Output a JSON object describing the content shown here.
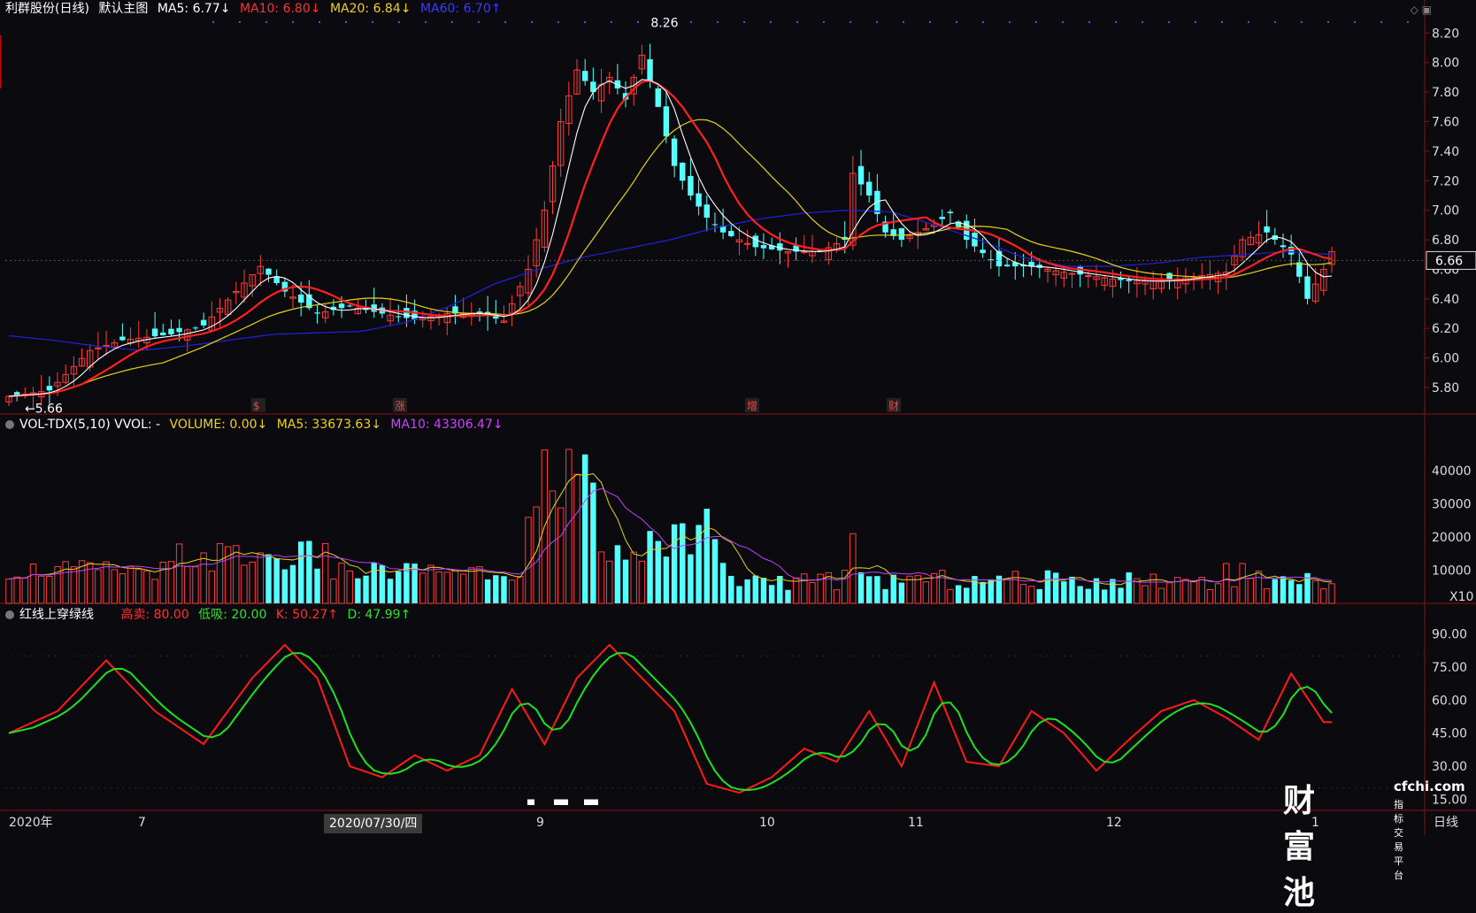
{
  "main_header": {
    "title": "利群股份(日线)",
    "subtitle": "默认主图",
    "ma5": "MA5: 6.77↓",
    "ma10": "MA10: 6.80↓",
    "ma20": "MA20: 6.84↓",
    "ma60": "MA60: 6.70↑"
  },
  "vol_header": {
    "name": "VOL-TDX(5,10) VVOL: -",
    "volume": "VOLUME: 0.00↓",
    "ma5": "MA5: 33673.63↓",
    "ma10": "MA10: 43306.47↓"
  },
  "kdj_header": {
    "name": "红线上穿绿线",
    "high": "高卖: 80.00",
    "low": "低吸: 20.00",
    "k": "K: 50.27↑",
    "d": "D: 47.99↑"
  },
  "price_axis": [
    "8.20",
    "8.00",
    "7.80",
    "7.60",
    "7.40",
    "7.20",
    "7.00",
    "6.80",
    "6.60",
    "6.40",
    "6.20",
    "6.00",
    "5.80"
  ],
  "current_price": "6.66",
  "high_marker": "8.26",
  "low_marker": "←5.66",
  "event_markers": [
    "$",
    "涨",
    "增",
    "财"
  ],
  "vol_axis": [
    "40000",
    "30000",
    "20000",
    "10000",
    "X10"
  ],
  "kdj_axis": [
    "90.00",
    "75.00",
    "60.00",
    "45.00",
    "30.00",
    "15.00"
  ],
  "x_axis": [
    "2020年",
    "7",
    "9",
    "10",
    "11",
    "12",
    "1"
  ],
  "cursor_date": "2020/07/30/四",
  "period_label": "日线",
  "watermark": {
    "brand": "财富池",
    "domain": "cfchi.com",
    "tagline": "指标交易平台"
  },
  "colors": {
    "up": "#ff3b3b",
    "down": "#54ffff",
    "ma5": "#ffffff",
    "ma10": "#ff2020",
    "ma20": "#e6d21a",
    "ma60": "#2020d0",
    "vma10": "#c040ff",
    "k": "#ff1a1a",
    "d": "#20e020"
  },
  "chart_data": {
    "type": "line",
    "title": "利群股份(日线)",
    "ylim": [
      5.6,
      8.3
    ],
    "series": [
      {
        "name": "MA60",
        "values": [
          6.15,
          6.12,
          6.08,
          6.05,
          6.08,
          6.12,
          6.16,
          6.17,
          6.18,
          6.24,
          6.35,
          6.5,
          6.6,
          6.68,
          6.74,
          6.8,
          6.88,
          6.94,
          6.98,
          7.0,
          6.99,
          6.9,
          6.8,
          6.68,
          6.62,
          6.62,
          6.64,
          6.68,
          6.7,
          6.72,
          6.7
        ]
      },
      {
        "name": "close",
        "values": [
          5.72,
          6.1,
          6.15,
          6.45,
          6.4,
          6.25,
          6.3,
          6.3,
          6.28,
          6.3,
          7.8,
          8.0,
          7.4,
          7.1,
          6.85,
          6.78,
          7.2,
          6.85,
          6.95,
          6.55,
          6.6,
          6.5,
          6.55,
          6.7,
          6.7,
          6.4,
          6.75,
          6.85,
          6.9,
          6.75,
          6.72
        ]
      }
    ]
  }
}
